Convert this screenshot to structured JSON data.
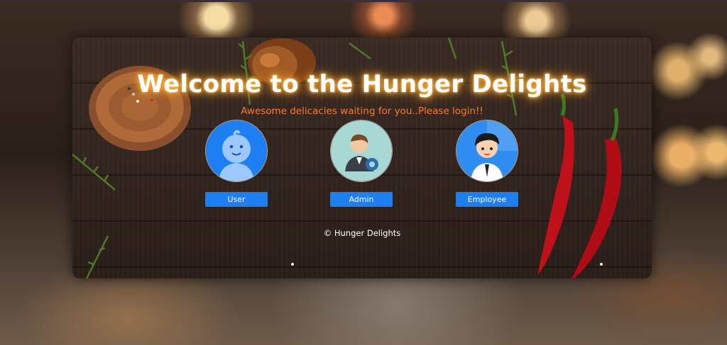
{
  "hero": {
    "title": "Welcome to the Hunger Delights",
    "subtitle": "Awesome delicacies waiting for you..Please login!!"
  },
  "roles": [
    {
      "label": "User",
      "icon": "baby-avatar-icon"
    },
    {
      "label": "Admin",
      "icon": "admin-avatar-icon"
    },
    {
      "label": "Employee",
      "icon": "employee-avatar-icon"
    }
  ],
  "footer": {
    "text": "© Hunger Delights"
  },
  "colors": {
    "button": "#1e7ff2",
    "title_glow": "#ffb03a",
    "subtitle": "#ff7a2a"
  }
}
